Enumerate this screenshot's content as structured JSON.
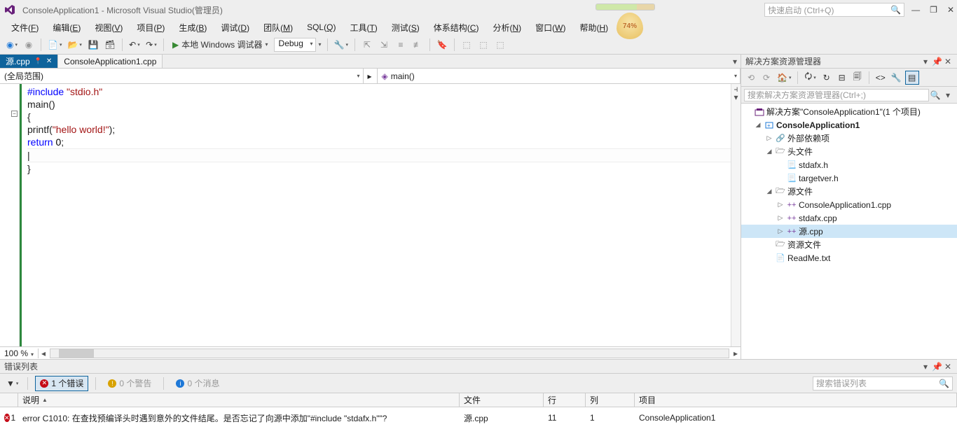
{
  "title": "ConsoleApplication1 - Microsoft Visual Studio(管理员)",
  "quicklaunch_placeholder": "快速启动 (Ctrl+Q)",
  "drop_badge": "74%",
  "menu": [
    "文件(F)",
    "编辑(E)",
    "视图(V)",
    "项目(P)",
    "生成(B)",
    "调试(D)",
    "团队(M)",
    "SQL(Q)",
    "工具(T)",
    "测试(S)",
    "体系结构(C)",
    "分析(N)",
    "窗口(W)",
    "帮助(H)"
  ],
  "toolbar": {
    "debug_label": "本地 Windows 调试器",
    "config": "Debug"
  },
  "tabs": [
    {
      "label": "源.cpp",
      "active": true
    },
    {
      "label": "ConsoleApplication1.cpp",
      "active": false
    }
  ],
  "nav_left": "(全局范围)",
  "nav_right": "main()",
  "code_lines": [
    {
      "t": "#include",
      "cls": "kw",
      "rest": " ",
      "str": "\"stdio.h\""
    },
    {
      "t": ""
    },
    {
      "t": "main()"
    },
    {
      "t": "{"
    },
    {
      "t": ""
    },
    {
      "t": "printf(",
      "str": "\"hello world!\"",
      "rest2": ");"
    },
    {
      "t": ""
    },
    {
      "t": "return ",
      "cls": "kw",
      "num": "0",
      "rest2": ";"
    },
    {
      "t": "|",
      "caret": true
    },
    {
      "t": "}"
    }
  ],
  "zoom": "100 %",
  "solexp": {
    "title": "解决方案资源管理器",
    "search_placeholder": "搜索解决方案资源管理器(Ctrl+;)",
    "root": "解决方案\"ConsoleApplication1\"(1 个项目)",
    "project": "ConsoleApplication1",
    "ext_deps": "外部依赖项",
    "headers": "头文件",
    "header_files": [
      "stdafx.h",
      "targetver.h"
    ],
    "sources": "源文件",
    "source_files": [
      "ConsoleApplication1.cpp",
      "stdafx.cpp",
      "源.cpp"
    ],
    "res": "资源文件",
    "readme": "ReadMe.txt"
  },
  "errlist": {
    "title": "错误列表",
    "filters": {
      "errors": "1 个错误",
      "warnings": "0 个警告",
      "messages": "0 个消息"
    },
    "search_placeholder": "搜索错误列表",
    "columns": {
      "desc": "说明",
      "file": "文件",
      "line": "行",
      "col": "列",
      "proj": "项目"
    },
    "rows": [
      {
        "num": "1",
        "desc": "error C1010: 在查找预编译头时遇到意外的文件结尾。是否忘记了向源中添加\"#include \"stdafx.h\"\"?",
        "file": "源.cpp",
        "line": "11",
        "col": "1",
        "proj": "ConsoleApplication1"
      }
    ]
  }
}
